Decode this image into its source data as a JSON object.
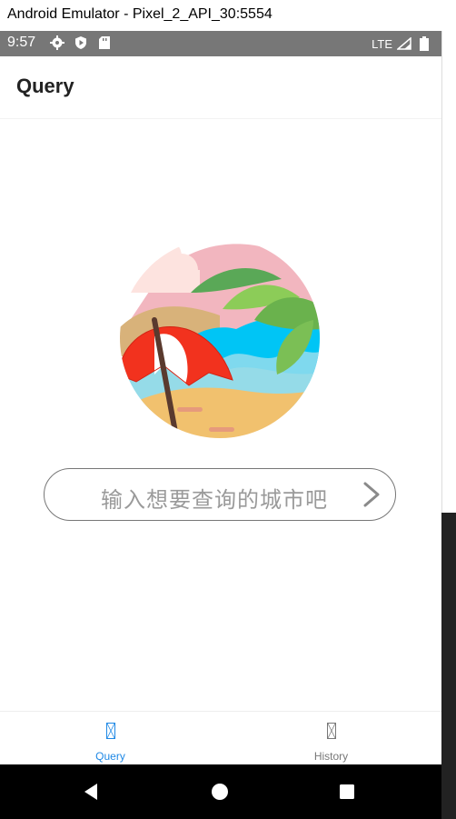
{
  "window": {
    "title": "Android Emulator - Pixel_2_API_30:5554"
  },
  "status_bar": {
    "time": "9:57",
    "network": "LTE"
  },
  "app_bar": {
    "title": "Query"
  },
  "search": {
    "placeholder": "输入想要查询的城市吧"
  },
  "bottom_nav": {
    "items": [
      {
        "label": "Query",
        "active": true
      },
      {
        "label": "History",
        "active": false
      }
    ],
    "active_color": "#1e88e5",
    "inactive_color": "#777777"
  },
  "icons": {
    "status": [
      "gear-icon",
      "play-protect-icon",
      "sd-card-icon",
      "signal-icon",
      "battery-icon"
    ],
    "system_nav": [
      "back-icon",
      "home-icon",
      "recents-icon"
    ]
  }
}
